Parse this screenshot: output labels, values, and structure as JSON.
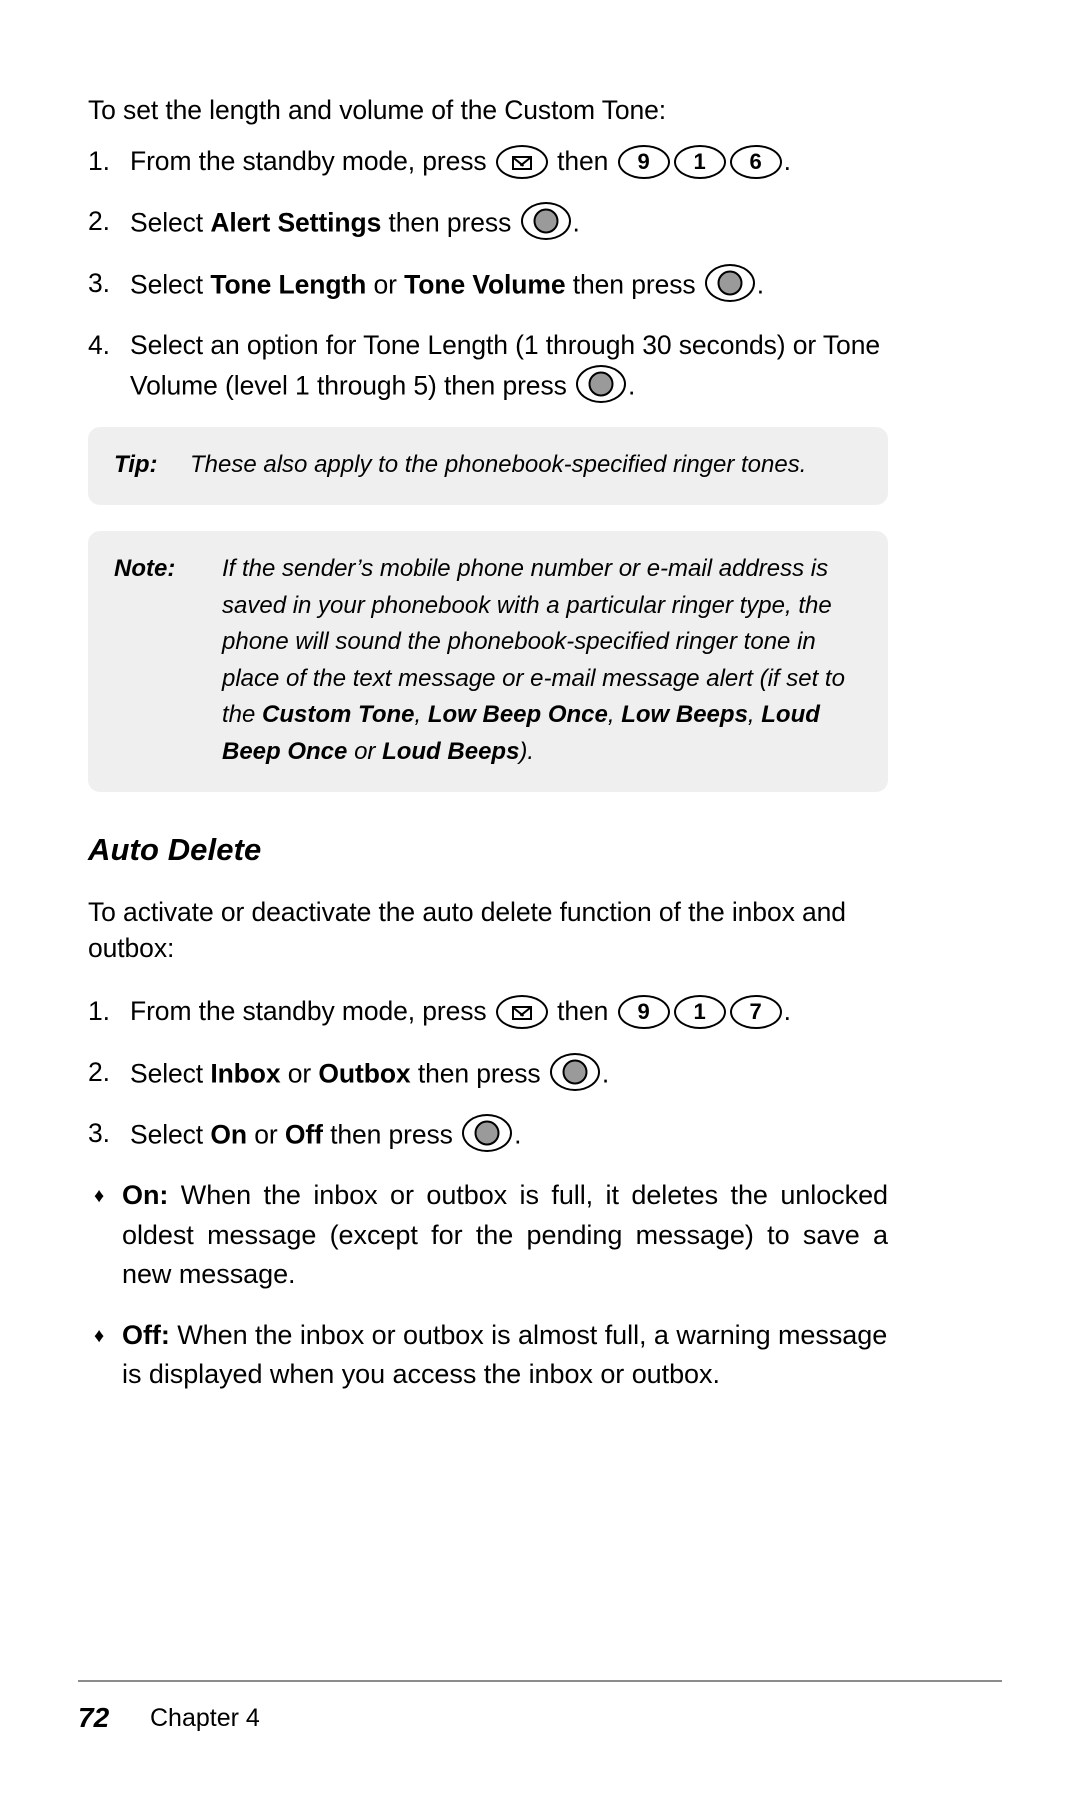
{
  "document": {
    "intro": "To set the length and volume of the Custom Tone:"
  },
  "custom_tone_steps": [
    {
      "num": "1.",
      "seg_a": "From the standby mode, press",
      "seg_b": "then",
      "keys": [
        "message",
        "9",
        "1",
        "6"
      ],
      "seg_c": "."
    },
    {
      "num": "2.",
      "seg_a": "Select",
      "bold_a": "Alert Settings",
      "seg_b": "then press",
      "seg_c": "."
    },
    {
      "num": "3.",
      "seg_a": "Select",
      "bold_a": "Tone Length",
      "seg_mid": "or",
      "bold_b": "Tone Volume",
      "seg_b": "then press",
      "seg_c": "."
    },
    {
      "num": "4.",
      "seg_a": "Select an option for Tone Length (1 through 30 seconds) or Tone Volume (level 1 through 5) then press",
      "seg_c": "."
    }
  ],
  "tip": {
    "label": "Tip:",
    "text": "These also apply to the phonebook-specified ringer tones."
  },
  "note": {
    "label": "Note:",
    "line1": "If the sender’s mobile phone number or e-mail address is saved in your phonebook with a particular ringer type, the phone will sound the phonebook-specified ringer tone in place of the text message or e-mail message alert (if set to the",
    "bold1": "Custom Tone",
    "sep1": ",",
    "bold2": "Low Beep Once",
    "sep2": ",",
    "bold3": "Low Beeps",
    "sep3": ",",
    "bold4": "Loud Beep Once",
    "conj": "or",
    "bold5": "Loud Beeps",
    "tail": ")."
  },
  "auto_delete": {
    "heading": "Auto Delete",
    "intro": "To activate or deactivate the auto delete function of the inbox and outbox:",
    "steps": [
      {
        "num": "1.",
        "seg_a": "From the standby mode, press",
        "seg_b": "then",
        "keys": [
          "message",
          "9",
          "1",
          "7"
        ],
        "seg_c": "."
      },
      {
        "num": "2.",
        "seg_a": "Select",
        "bold_a": "Inbox",
        "seg_mid": "or",
        "bold_b": "Outbox",
        "seg_b": "then press",
        "seg_c": "."
      },
      {
        "num": "3.",
        "seg_a": "Select",
        "bold_a": "On",
        "seg_mid": "or",
        "bold_b": "Off",
        "seg_b": "then press",
        "seg_c": "."
      }
    ],
    "bullets": [
      {
        "marker": "♦",
        "bold": "On:",
        "text": "When the inbox or outbox is full, it deletes the unlocked oldest message (except for the pending message) to save a new message."
      },
      {
        "marker": "♦",
        "bold": "Off:",
        "text": "When the inbox or outbox is almost full, a warning message is displayed when you access the inbox or outbox."
      }
    ]
  },
  "footer": {
    "page_number": "72",
    "chapter": "Chapter 4"
  },
  "keys": {
    "message_icon": "envelope-icon",
    "ok_icon": "ok-select-icon",
    "d9": "9",
    "d1": "1",
    "d6": "6",
    "d7": "7"
  },
  "colors": {
    "callout_bg": "#efefef",
    "key_fill": "#9a9a9a",
    "rule": "#8c8c8c",
    "text": "#000000"
  }
}
